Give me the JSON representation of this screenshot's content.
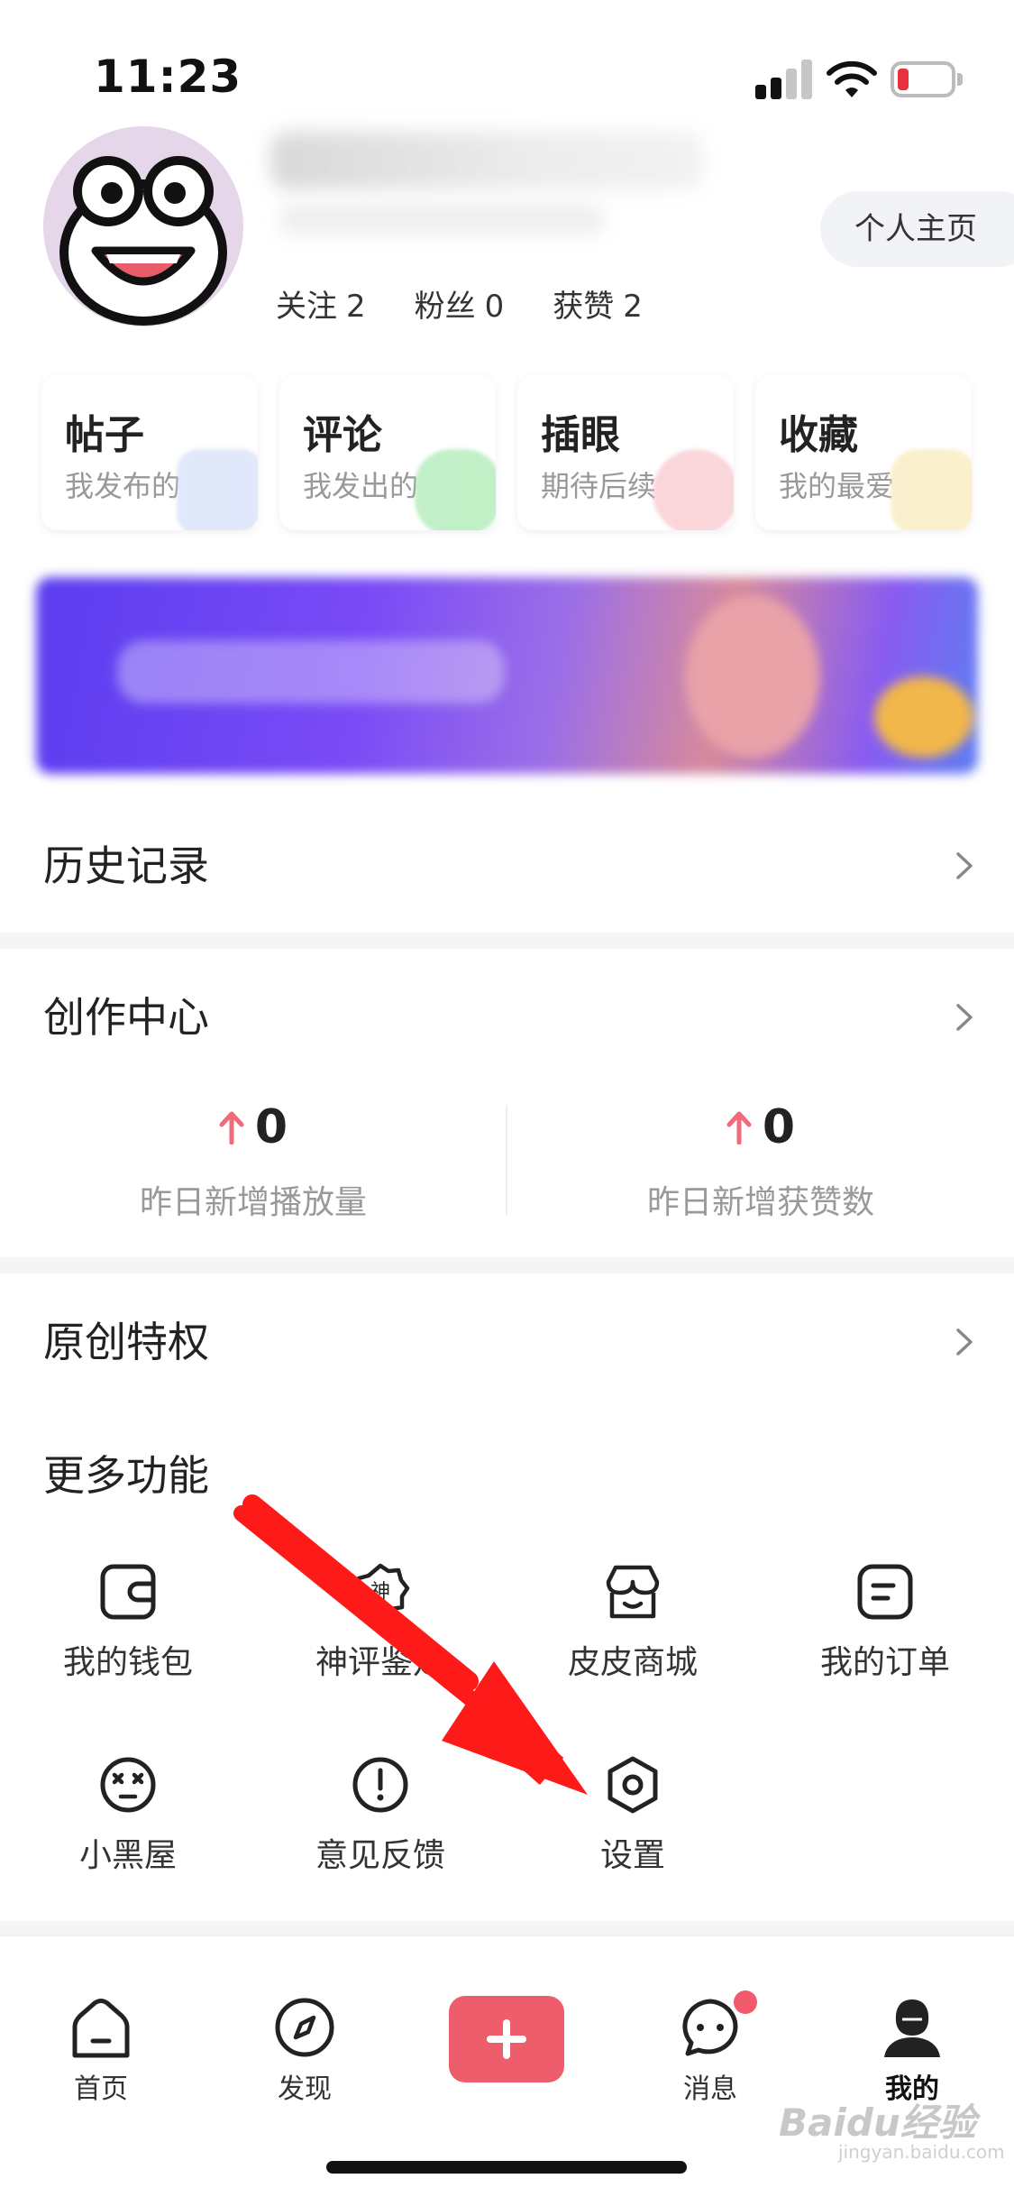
{
  "status_bar": {
    "time": "11:23"
  },
  "profile": {
    "stats": [
      {
        "label": "关注",
        "value": "2"
      },
      {
        "label": "粉丝",
        "value": "0"
      },
      {
        "label": "获赞",
        "value": "2"
      }
    ],
    "homepage_button": "个人主页"
  },
  "quick_cards": [
    {
      "title": "帖子",
      "subtitle": "我发布的",
      "color": "#c9d6f7"
    },
    {
      "title": "评论",
      "subtitle": "我发出的",
      "color": "#8fe39a"
    },
    {
      "title": "插眼",
      "subtitle": "期待后续",
      "color": "#f7b4bd"
    },
    {
      "title": "收藏",
      "subtitle": "我的最爱",
      "color": "#f7e3a6"
    }
  ],
  "menu": {
    "history": "历史记录",
    "creation_center": "创作中心",
    "original_privilege": "原创特权",
    "more_functions": "更多功能"
  },
  "metrics": [
    {
      "value": "0",
      "caption": "昨日新增播放量"
    },
    {
      "value": "0",
      "caption": "昨日新增获赞数"
    }
  ],
  "functions": [
    {
      "label": "我的钱包",
      "icon": "wallet-icon"
    },
    {
      "label": "神评鉴定",
      "icon": "badge-icon",
      "icon_text": "神"
    },
    {
      "label": "皮皮商城",
      "icon": "shop-icon"
    },
    {
      "label": "我的订单",
      "icon": "order-icon"
    },
    {
      "label": "小黑屋",
      "icon": "dizzy-face-icon"
    },
    {
      "label": "意见反馈",
      "icon": "exclamation-icon"
    },
    {
      "label": "设置",
      "icon": "settings-hexagon-icon"
    }
  ],
  "tabbar": [
    {
      "label": "首页",
      "icon": "home-icon"
    },
    {
      "label": "发现",
      "icon": "compass-icon"
    },
    {
      "label": "",
      "icon": "plus-icon"
    },
    {
      "label": "消息",
      "icon": "chat-bubble-icon"
    },
    {
      "label": "我的",
      "icon": "profile-icon",
      "active": true
    }
  ],
  "watermark": {
    "text": "Baidu经验",
    "sub": "jingyan.baidu.com"
  },
  "colors": {
    "accent": "#ee5d6c",
    "arrow": "#ff1a1a",
    "up_arrow": "#f06a7a"
  }
}
